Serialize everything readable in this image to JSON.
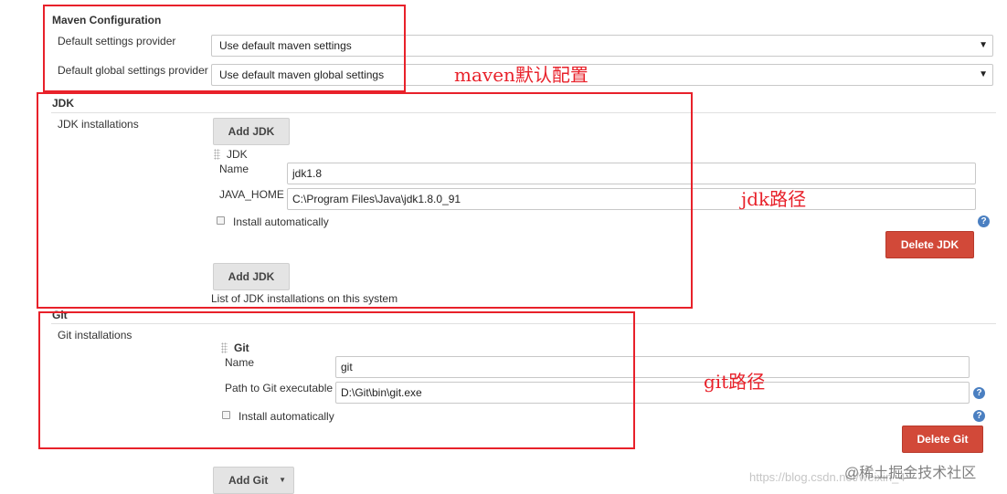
{
  "maven": {
    "title": "Maven Configuration",
    "default_settings_label": "Default settings provider",
    "default_settings_value": "Use default maven settings",
    "global_settings_label": "Default global settings provider",
    "global_settings_value": "Use default maven global settings"
  },
  "jdk": {
    "title": "JDK",
    "installations_label": "JDK installations",
    "add_button": "Add JDK",
    "item_header": "JDK",
    "name_label": "Name",
    "name_value": "jdk1.8",
    "home_label": "JAVA_HOME",
    "home_value": "C:\\Program Files\\Java\\jdk1.8.0_91",
    "install_auto_label": "Install automatically",
    "delete_button": "Delete JDK",
    "add_button_bottom": "Add JDK",
    "description": "List of JDK installations on this system"
  },
  "git": {
    "title": "Git",
    "installations_label": "Git installations",
    "item_header": "Git",
    "name_label": "Name",
    "name_value": "git",
    "path_label": "Path to Git executable",
    "path_value": "D:\\Git\\bin\\git.exe",
    "install_auto_label": "Install automatically",
    "delete_button": "Delete Git",
    "add_button": "Add Git"
  },
  "annotations": {
    "maven_note": "maven默认配置",
    "jdk_note": "jdk路径",
    "git_note": "git路径"
  },
  "watermark": {
    "url_text": "https://blog.csdn.net/weixin_4",
    "brand_text": "@稀土掘金技术社区"
  },
  "colors": {
    "annotation_red": "#e8212a",
    "delete_button": "#d24939",
    "help_icon": "#4a7fc1"
  }
}
